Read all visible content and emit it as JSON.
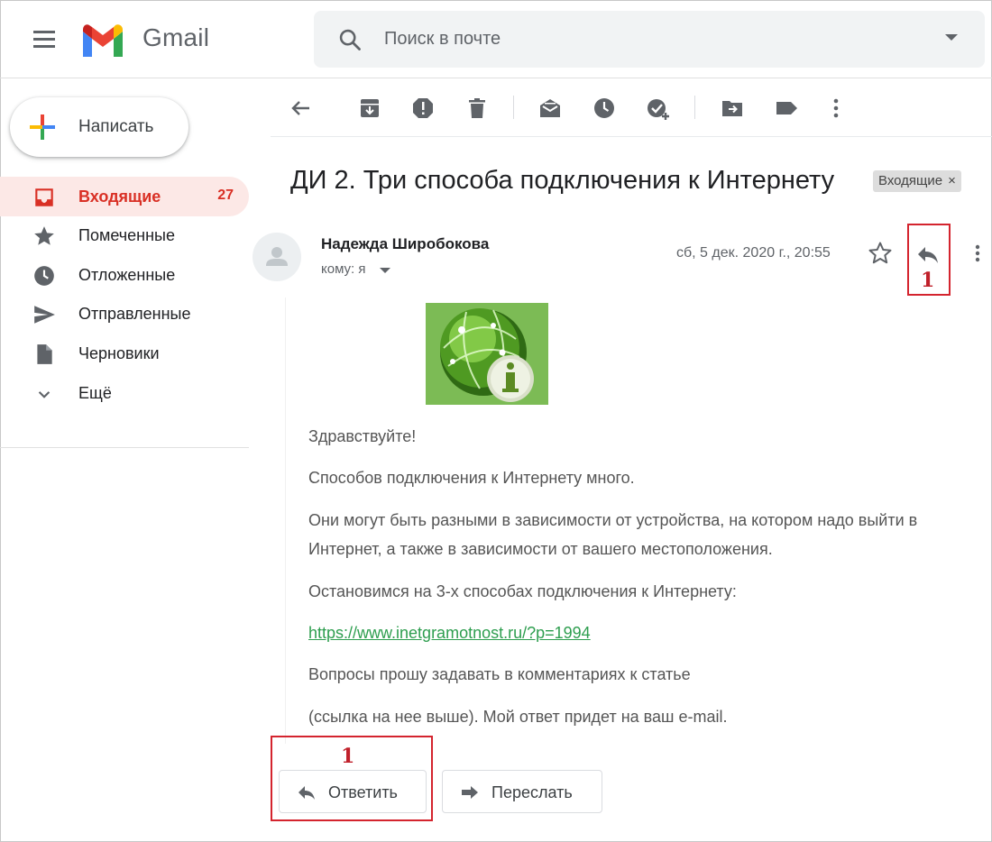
{
  "header": {
    "app_name": "Gmail",
    "search": {
      "placeholder": "Поиск в почте"
    }
  },
  "sidebar": {
    "compose_label": "Написать",
    "items": [
      {
        "label": "Входящие",
        "count": "27",
        "icon": "inbox-icon",
        "active": true
      },
      {
        "label": "Помеченные",
        "icon": "star-icon"
      },
      {
        "label": "Отложенные",
        "icon": "clock-icon"
      },
      {
        "label": "Отправленные",
        "icon": "send-icon"
      },
      {
        "label": "Черновики",
        "icon": "draft-icon"
      },
      {
        "label": "Ещё",
        "icon": "chevron-down-icon"
      }
    ]
  },
  "toolbar": {
    "icons": [
      "back-arrow-icon",
      "archive-icon",
      "report-spam-icon",
      "delete-icon",
      "mark-unread-icon",
      "snooze-icon",
      "add-task-icon",
      "move-to-icon",
      "label-icon",
      "more-vert-icon"
    ]
  },
  "message": {
    "subject": "ДИ 2. Три способа подключения к Интернету",
    "label_chip": "Входящие",
    "label_chip_close": "×",
    "sender": "Надежда Широбокова",
    "to": "кому: я",
    "date": "сб, 5 дек. 2020 г., 20:55",
    "body": [
      "Здравствуйте!",
      "Способов подключения к Интернету много.",
      "Они могут быть разными в зависимости от устройства, на котором надо выйти в",
      "Интернет, а также в зависимости от вашего местоположения.",
      "Остановимся на 3-х способах подключения к Интернету:",
      "Вопросы прошу задавать в комментариях к статье",
      "(ссылка на нее выше). Мой ответ придет на ваш e-mail."
    ],
    "link": "https://www.inetgramotnost.ru/?p=1994"
  },
  "actions": {
    "reply_label": "Ответить",
    "forward_label": "Переслать"
  },
  "annotations": {
    "top_number": "1",
    "bottom_number": "1",
    "highlight_color": "#d4242e"
  },
  "colors": {
    "accent_red": "#d93025",
    "active_bg": "#fce8e6",
    "link_green": "#2e9e4f",
    "search_bg": "#f1f3f4"
  }
}
